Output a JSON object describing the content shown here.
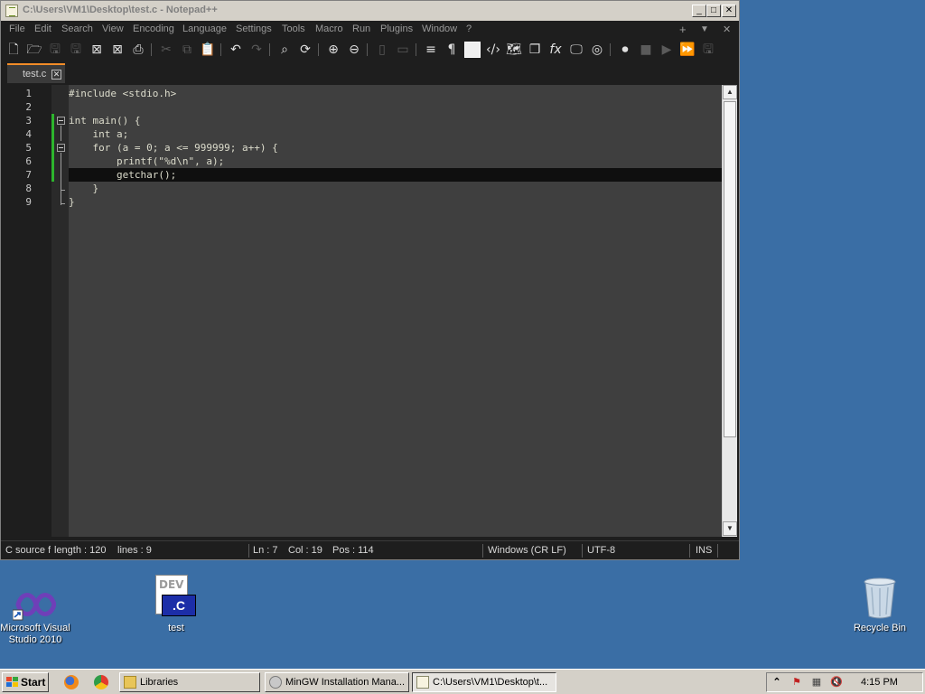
{
  "window": {
    "title": "C:\\Users\\VM1\\Desktop\\test.c - Notepad++",
    "minimize": "_",
    "maximize": "□",
    "close": "✕"
  },
  "menu": [
    "File",
    "Edit",
    "Search",
    "View",
    "Encoding",
    "Language",
    "Settings",
    "Tools",
    "Macro",
    "Run",
    "Plugins",
    "Window",
    "?"
  ],
  "menu_right": [
    "+",
    "▼",
    "✕"
  ],
  "tab": {
    "label": "test.c",
    "close": "✕"
  },
  "editor": {
    "line_numbers": [
      "1",
      "2",
      "3",
      "4",
      "5",
      "6",
      "7",
      "8",
      "9"
    ],
    "lines": [
      "#include <stdio.h>",
      "",
      "int main() {",
      "    int a;",
      "    for (a = 0; a <= 999999; a++) {",
      "        printf(\"%d\\n\", a);",
      "        getchar();",
      "    }",
      "}"
    ],
    "active_line": 7
  },
  "status": {
    "lang": "C source f",
    "length": "length : 120",
    "lines": "lines : 9",
    "ln": "Ln : 7",
    "col": "Col : 19",
    "pos": "Pos : 114",
    "eol": "Windows (CR LF)",
    "encoding": "UTF-8",
    "mode": "INS"
  },
  "desktop": {
    "vs_label_1": "Microsoft Visual",
    "vs_label_2": "Studio 2010",
    "cfile_label": "test",
    "cfile_badge": ".C",
    "cfile_header": "DEV",
    "bin_label": "Recycle Bin"
  },
  "taskbar": {
    "start": "Start",
    "tasks": [
      "Libraries",
      "MinGW Installation Mana...",
      "C:\\Users\\VM1\\Desktop\\t..."
    ],
    "clock": "4:15 PM"
  }
}
